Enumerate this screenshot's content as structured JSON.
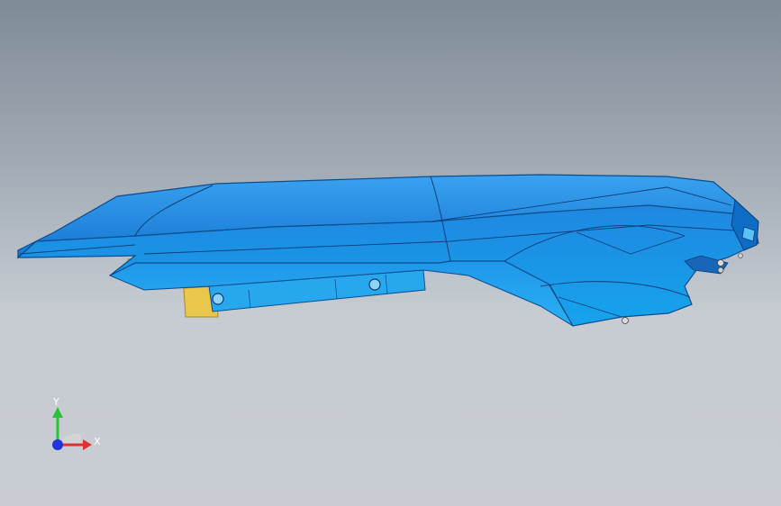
{
  "viewport": {
    "background_top": "#7f8b98",
    "background_bottom": "#c9cdd3"
  },
  "model": {
    "part_color": "#1f8fe8",
    "part_dark": "#0b5fb0",
    "bracket_color": "#e8c24a"
  },
  "triad": {
    "x_label": "X",
    "y_label": "Y",
    "x_color": "#e23030",
    "y_color": "#2fbf3a",
    "z_color": "#2235d8"
  }
}
